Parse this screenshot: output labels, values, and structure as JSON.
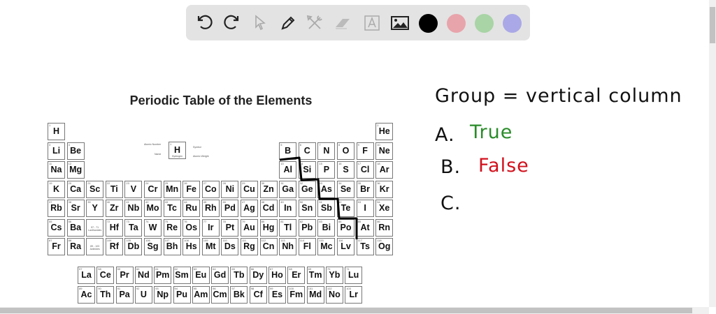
{
  "toolbar": {
    "tools": [
      {
        "icon": "undo-icon"
      },
      {
        "icon": "redo-icon"
      },
      {
        "icon": "pointer-icon"
      },
      {
        "icon": "pen-icon"
      },
      {
        "icon": "tools-icon"
      },
      {
        "icon": "eraser-icon"
      },
      {
        "icon": "text-icon"
      },
      {
        "icon": "image-icon"
      }
    ],
    "colors": [
      "#000000",
      "#e8a4ab",
      "#a9d4a6",
      "#aaa8e6"
    ]
  },
  "title": "Periodic Table of the Elements",
  "legend": {
    "symbol": "H",
    "number": "1",
    "name": "Hydrogen",
    "labels": [
      "Atomic Number",
      "Name",
      "Symbol",
      "Atomic Weight"
    ]
  },
  "placeholders": [
    "57 - 71 Lanthanides",
    "89 - 103 Actinides"
  ],
  "elements": [
    "H",
    "He",
    "Li",
    "Be",
    "B",
    "C",
    "N",
    "O",
    "F",
    "Ne",
    "Na",
    "Mg",
    "Al",
    "Si",
    "P",
    "S",
    "Cl",
    "Ar",
    "K",
    "Ca",
    "Sc",
    "Ti",
    "V",
    "Cr",
    "Mn",
    "Fe",
    "Co",
    "Ni",
    "Cu",
    "Zn",
    "Ga",
    "Ge",
    "As",
    "Se",
    "Br",
    "Kr",
    "Rb",
    "Sr",
    "Y",
    "Zr",
    "Nb",
    "Mo",
    "Tc",
    "Ru",
    "Rh",
    "Pd",
    "Ag",
    "Cd",
    "In",
    "Sn",
    "Sb",
    "Te",
    "I",
    "Xe",
    "Cs",
    "Ba",
    "La",
    "Ce",
    "Pr",
    "Nd",
    "Pm",
    "Sm",
    "Eu",
    "Gd",
    "Tb",
    "Dy",
    "Ho",
    "Er",
    "Tm",
    "Yb",
    "Lu",
    "Hf",
    "Ta",
    "W",
    "Re",
    "Os",
    "Ir",
    "Pt",
    "Au",
    "Hg",
    "Tl",
    "Pb",
    "Bi",
    "Po",
    "At",
    "Rn",
    "Fr",
    "Ra",
    "Ac",
    "Th",
    "Pa",
    "U",
    "Np",
    "Pu",
    "Am",
    "Cm",
    "Bk",
    "Cf",
    "Es",
    "Fm",
    "Md",
    "No",
    "Lr",
    "Rf",
    "Db",
    "Sg",
    "Bh",
    "Hs",
    "Mt",
    "Ds",
    "Rg",
    "Cn",
    "Nh",
    "Fl",
    "Mc",
    "Lv",
    "Ts",
    "Og"
  ],
  "notes": {
    "line1": "Group = vertical column",
    "a_label": "A.",
    "a_text": "True",
    "a_color": "#2a8c2a",
    "b_label": "B.",
    "b_text": "False",
    "b_color": "#d2101c",
    "c_label": "C."
  }
}
